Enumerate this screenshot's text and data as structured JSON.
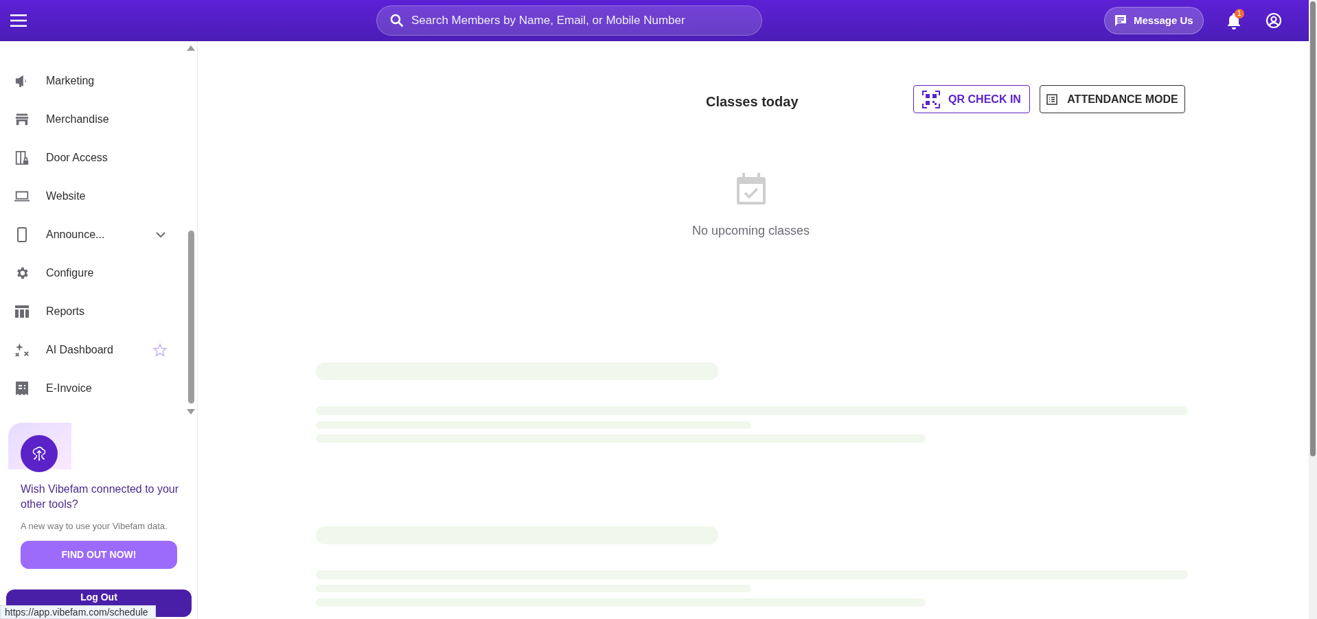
{
  "top_bar": {
    "search": {
      "placeholder": "Search Members by Name, Email, or Mobile Number"
    },
    "message_button": "Message Us",
    "notification_count": "1"
  },
  "sidebar": {
    "items": [
      {
        "label": "Marketing"
      },
      {
        "label": "Merchandise"
      },
      {
        "label": "Door Access"
      },
      {
        "label": "Website"
      },
      {
        "label": "Announce...",
        "expanded": false
      },
      {
        "label": "Configure"
      },
      {
        "label": "Reports"
      },
      {
        "label": "AI Dashboard",
        "favorite": false
      },
      {
        "label": "E-Invoice"
      }
    ],
    "promo": {
      "title": "Wish Vibefam connected to your other tools?",
      "text": "A new way to use your Vibefam data.",
      "button": "FIND OUT NOW!"
    },
    "logout": "Log Out"
  },
  "main": {
    "title": "Classes today",
    "buttons": [
      {
        "kind": "qr",
        "label": "QR CHECK IN"
      },
      {
        "kind": "list",
        "label": "ATTENDANCE MODE"
      }
    ],
    "empty_text": "No upcoming classes"
  },
  "status_url": "https://app.vibefam.com/schedule"
}
